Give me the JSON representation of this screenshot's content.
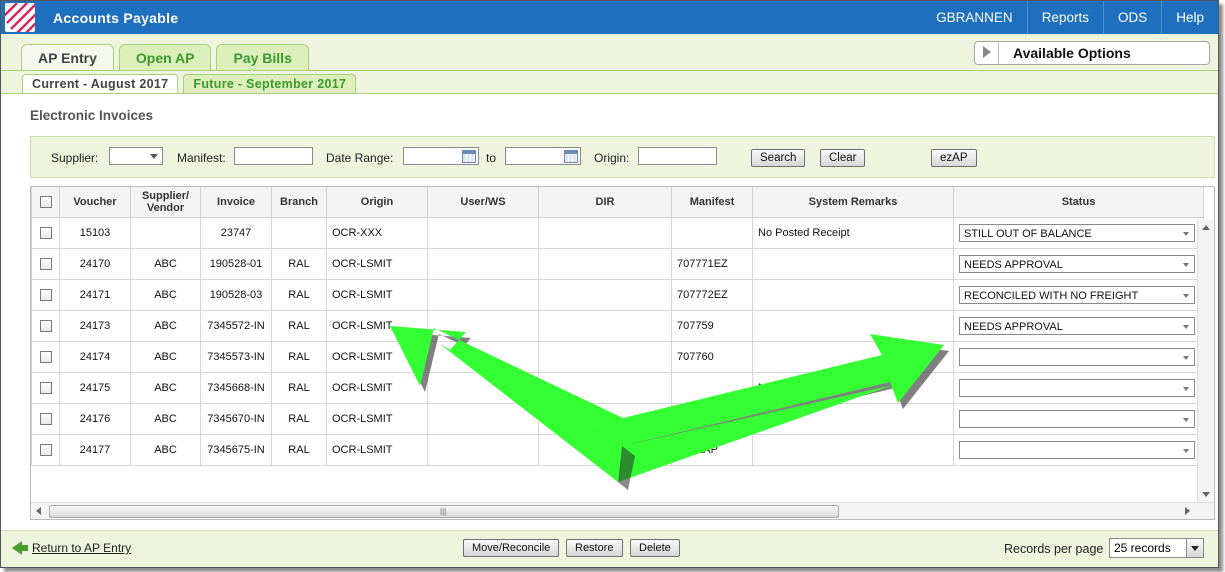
{
  "app": {
    "title": "Accounts Payable"
  },
  "topnav": {
    "user": "GBRANNEN",
    "reports": "Reports",
    "ods": "ODS",
    "help": "Help"
  },
  "tabs": [
    {
      "label": "AP Entry"
    },
    {
      "label": "Open AP"
    },
    {
      "label": "Pay Bills"
    }
  ],
  "options": {
    "label": "Available Options"
  },
  "subtabs": [
    {
      "label": "Current - August 2017"
    },
    {
      "label": "Future - September 2017"
    }
  ],
  "section": {
    "title": "Electronic Invoices"
  },
  "search": {
    "supplier_label": "Supplier:",
    "supplier_value": "",
    "manifest_label": "Manifest:",
    "manifest_value": "",
    "date_label": "Date Range:",
    "date_from": "",
    "to_label": "to",
    "date_to": "",
    "origin_label": "Origin:",
    "origin_value": "",
    "search_button": "Search",
    "clear_button": "Clear",
    "ezap_button": "ezAP"
  },
  "columns": {
    "voucher": "Voucher",
    "supplier": "Supplier/\nVendor",
    "invoice": "Invoice",
    "branch": "Branch",
    "origin": "Origin",
    "user": "User/WS",
    "dir": "DIR",
    "manifest": "Manifest",
    "remarks": "System Remarks",
    "status": "Status"
  },
  "rows": [
    {
      "voucher": "15103",
      "supplier": "",
      "invoice": "23747",
      "branch": "",
      "origin": "OCR-XXX",
      "user": "",
      "dir": "",
      "manifest": "",
      "remarks": "No Posted Receipt",
      "status": "STILL OUT OF BALANCE"
    },
    {
      "voucher": "24170",
      "supplier": "ABC",
      "invoice": "190528-01",
      "branch": "RAL",
      "origin": "OCR-LSMIT",
      "user": "",
      "dir": "",
      "manifest": "707771EZ",
      "remarks": "",
      "status": "NEEDS APPROVAL"
    },
    {
      "voucher": "24171",
      "supplier": "ABC",
      "invoice": "190528-03",
      "branch": "RAL",
      "origin": "OCR-LSMIT",
      "user": "",
      "dir": "",
      "manifest": "707772EZ",
      "remarks": "",
      "status": "RECONCILED WITH NO FREIGHT"
    },
    {
      "voucher": "24173",
      "supplier": "ABC",
      "invoice": "7345572-IN",
      "branch": "RAL",
      "origin": "OCR-LSMIT",
      "user": "",
      "dir": "",
      "manifest": "707759",
      "remarks": "",
      "status": "NEEDS APPROVAL"
    },
    {
      "voucher": "24174",
      "supplier": "ABC",
      "invoice": "7345573-IN",
      "branch": "RAL",
      "origin": "OCR-LSMIT",
      "user": "",
      "dir": "",
      "manifest": "707760",
      "remarks": "",
      "status": ""
    },
    {
      "voucher": "24175",
      "supplier": "ABC",
      "invoice": "7345668-IN",
      "branch": "RAL",
      "origin": "OCR-LSMIT",
      "user": "",
      "dir": "",
      "manifest": "",
      "remarks": "No Po",
      "status": ""
    },
    {
      "voucher": "24176",
      "supplier": "ABC",
      "invoice": "7345670-IN",
      "branch": "RAL",
      "origin": "OCR-LSMIT",
      "user": "",
      "dir": "",
      "manifest": "7077",
      "remarks": "",
      "status": ""
    },
    {
      "voucher": "24177",
      "supplier": "ABC",
      "invoice": "7345675-IN",
      "branch": "RAL",
      "origin": "OCR-LSMIT",
      "user": "",
      "dir": "",
      "manifest": "70EZAP",
      "remarks": "",
      "status": ""
    }
  ],
  "footer": {
    "back_link": "Return to AP Entry",
    "move_button": "Move/Reconcile",
    "restore_button": "Restore",
    "delete_button": "Delete",
    "rpp_label": "Records per page",
    "rpp_value": "25 records"
  },
  "colors": {
    "header": "#1e6fbd",
    "tab_green": "#3c9a2e",
    "panel": "#eef4de",
    "arrow": "#33ff33"
  }
}
